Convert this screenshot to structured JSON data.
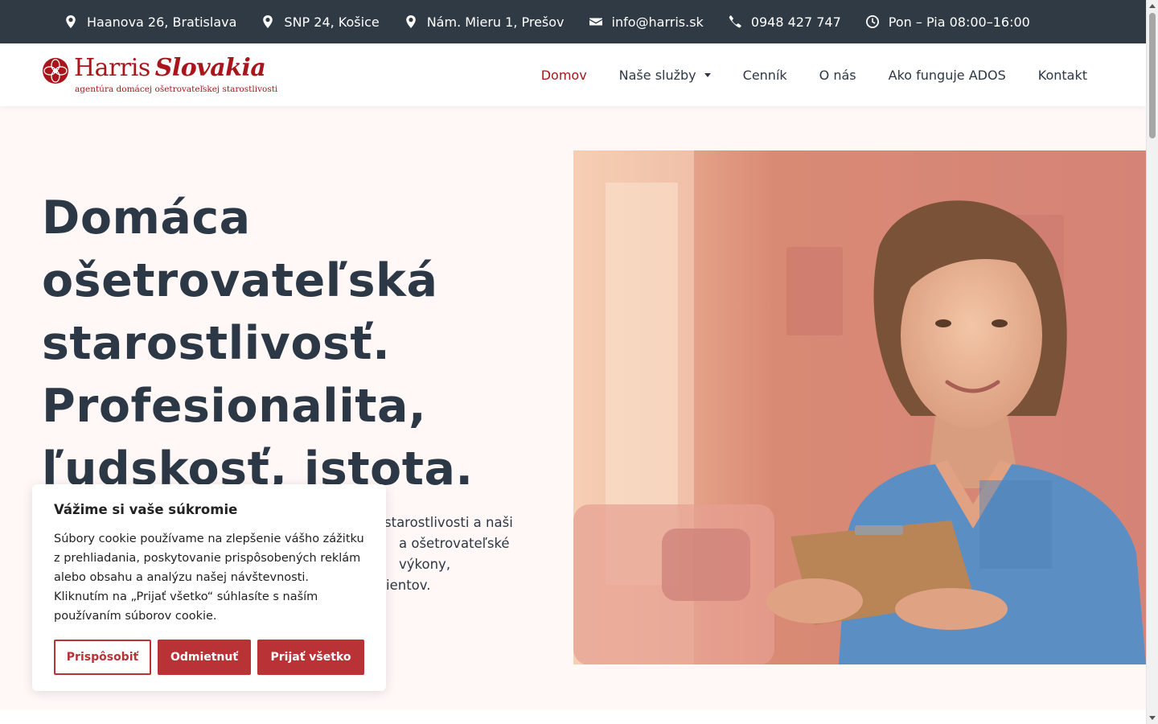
{
  "topbar": {
    "items": [
      {
        "icon": "map-marker-icon",
        "text": "Haanova 26, Bratislava"
      },
      {
        "icon": "map-marker-icon",
        "text": "SNP 24, Košice"
      },
      {
        "icon": "map-marker-icon",
        "text": "Nám. Mieru 1, Prešov"
      },
      {
        "icon": "envelope-icon",
        "text": "info@harris.sk"
      },
      {
        "icon": "phone-icon",
        "text": "0948 427 747"
      },
      {
        "icon": "clock-icon",
        "text": "Pon – Pia 08:00–16:00"
      }
    ]
  },
  "brand": {
    "name_part1": "Harris",
    "name_part2": "Slovakia",
    "tagline": "agentúra domácej ošetrovateľskej starostlivosti",
    "color": "#a8161c"
  },
  "nav": {
    "items": [
      {
        "label": "Domov",
        "active": true
      },
      {
        "label": "Naše služby",
        "dropdown": true
      },
      {
        "label": "Cenník"
      },
      {
        "label": "O nás"
      },
      {
        "label": "Ako funguje ADOS"
      },
      {
        "label": "Kontakt"
      }
    ]
  },
  "hero": {
    "title_lines": [
      "Domáca",
      "ošetrovateľská",
      "starostlivosť.",
      "Profesionalita,",
      "ľudskosť, istota."
    ],
    "text_lines": [
      "starostlivosti a naši",
      "a ošetrovateľské výkony,",
      "ientov."
    ]
  },
  "cookie": {
    "title": "Vážime si vaše súkromie",
    "text": "Súbory cookie používame na zlepšenie vášho zážitku z prehliadania, poskytovanie prispôsobených reklám alebo obsahu a analýzu našej návštevnosti. Kliknutím na „Prijať všetko“ súhlasíte s naším používaním súborov cookie.",
    "btn_customize": "Prispôsobiť",
    "btn_reject": "Odmietnuť",
    "btn_accept": "Prijať všetko",
    "accent": "#b83236"
  },
  "colors": {
    "topbar_bg": "#2f3a44",
    "text_dark": "#2c3845",
    "page_bg": "#fff8f7"
  }
}
